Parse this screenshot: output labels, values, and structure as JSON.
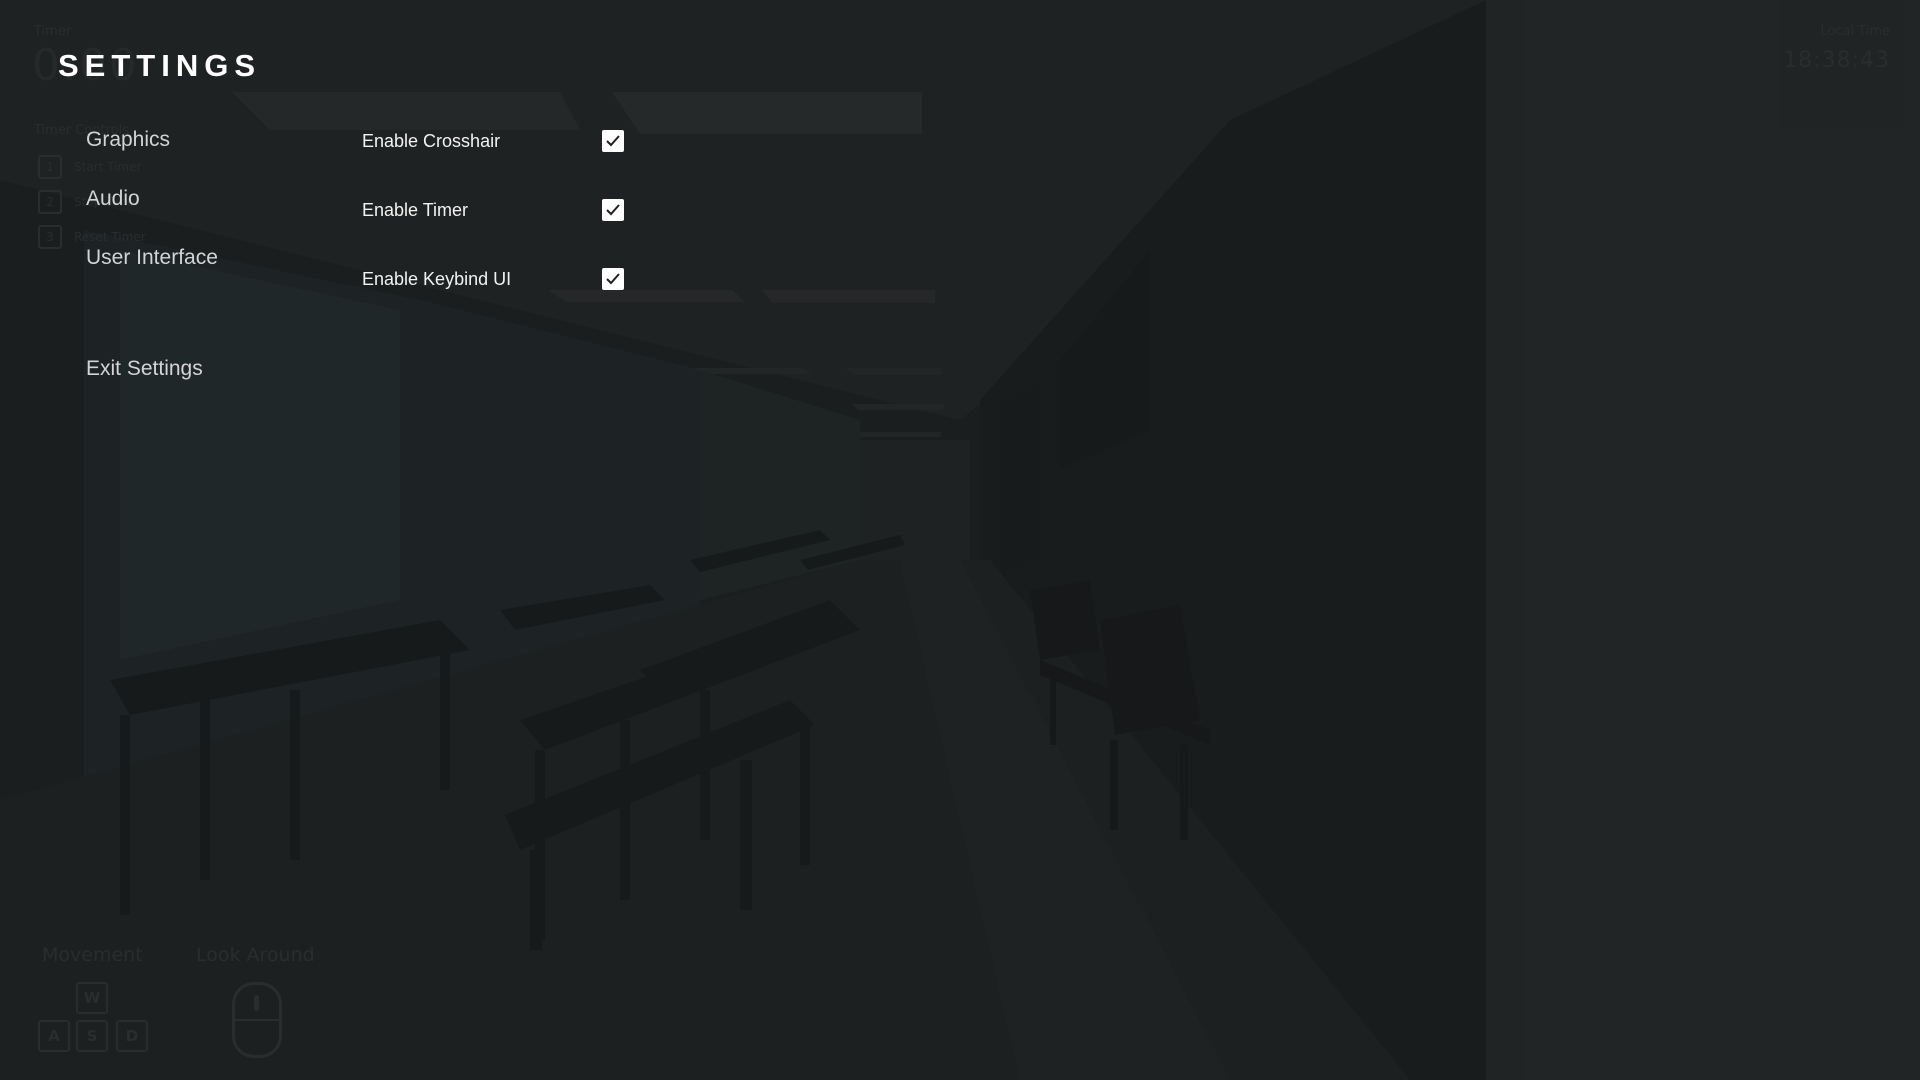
{
  "hud": {
    "timer_label": "Timer",
    "timer_value": "0:00",
    "timer_controls_title": "Timer Controls",
    "timer_controls": [
      {
        "key": "1",
        "label": "Start Timer"
      },
      {
        "key": "2",
        "label": "Stop Timer"
      },
      {
        "key": "3",
        "label": "Reset Timer"
      }
    ],
    "local_time_label": "Local Time",
    "local_time_value": "18:38:43",
    "movement_label": "Movement",
    "look_label": "Look Around",
    "keys": {
      "w": "W",
      "a": "A",
      "s": "S",
      "d": "D"
    }
  },
  "settings": {
    "title": "SETTINGS",
    "nav": {
      "graphics": "Graphics",
      "audio": "Audio",
      "user_interface": "User Interface",
      "exit": "Exit Settings"
    },
    "options": [
      {
        "label": "Enable Crosshair",
        "checked": true
      },
      {
        "label": "Enable Timer",
        "checked": true
      },
      {
        "label": "Enable Keybind UI",
        "checked": true
      }
    ]
  },
  "colors": {
    "background": "#1f2122",
    "title": "#ffffff",
    "nav_text": "#d2d4d6",
    "checkbox": "#ffffff",
    "check_mark": "#1f2122"
  }
}
